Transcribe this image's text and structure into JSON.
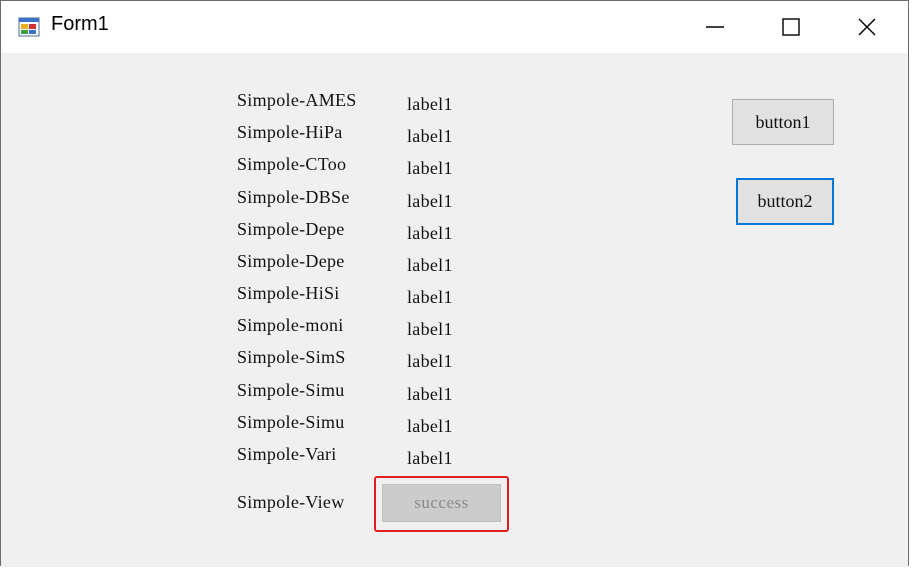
{
  "window": {
    "title": "Form1",
    "icon": "winforms-app-icon",
    "controls": [
      "minimize-icon",
      "maximize-icon",
      "close-icon"
    ]
  },
  "rows": [
    {
      "name": "Simpole-AMES",
      "value": "label1"
    },
    {
      "name": "Simpole-HiPa",
      "value": "label1"
    },
    {
      "name": "Simpole-CToo",
      "value": "label1"
    },
    {
      "name": "Simpole-DBSe",
      "value": "label1"
    },
    {
      "name": "Simpole-Depe",
      "value": "label1"
    },
    {
      "name": "Simpole-Depe",
      "value": "label1"
    },
    {
      "name": "Simpole-HiSi",
      "value": "label1"
    },
    {
      "name": "Simpole-moni",
      "value": "label1"
    },
    {
      "name": "Simpole-SimS",
      "value": "label1"
    },
    {
      "name": "Simpole-Simu",
      "value": "label1"
    },
    {
      "name": "Simpole-Simu",
      "value": "label1"
    },
    {
      "name": "Simpole-Vari",
      "value": "label1"
    }
  ],
  "last_row": {
    "name": "Simpole-View",
    "status": "success"
  },
  "buttons": {
    "button1": "button1",
    "button2": "button2"
  },
  "colors": {
    "focus_border": "#0078d7",
    "highlight_box": "#e02020",
    "client_bg": "#f0f0f0"
  }
}
